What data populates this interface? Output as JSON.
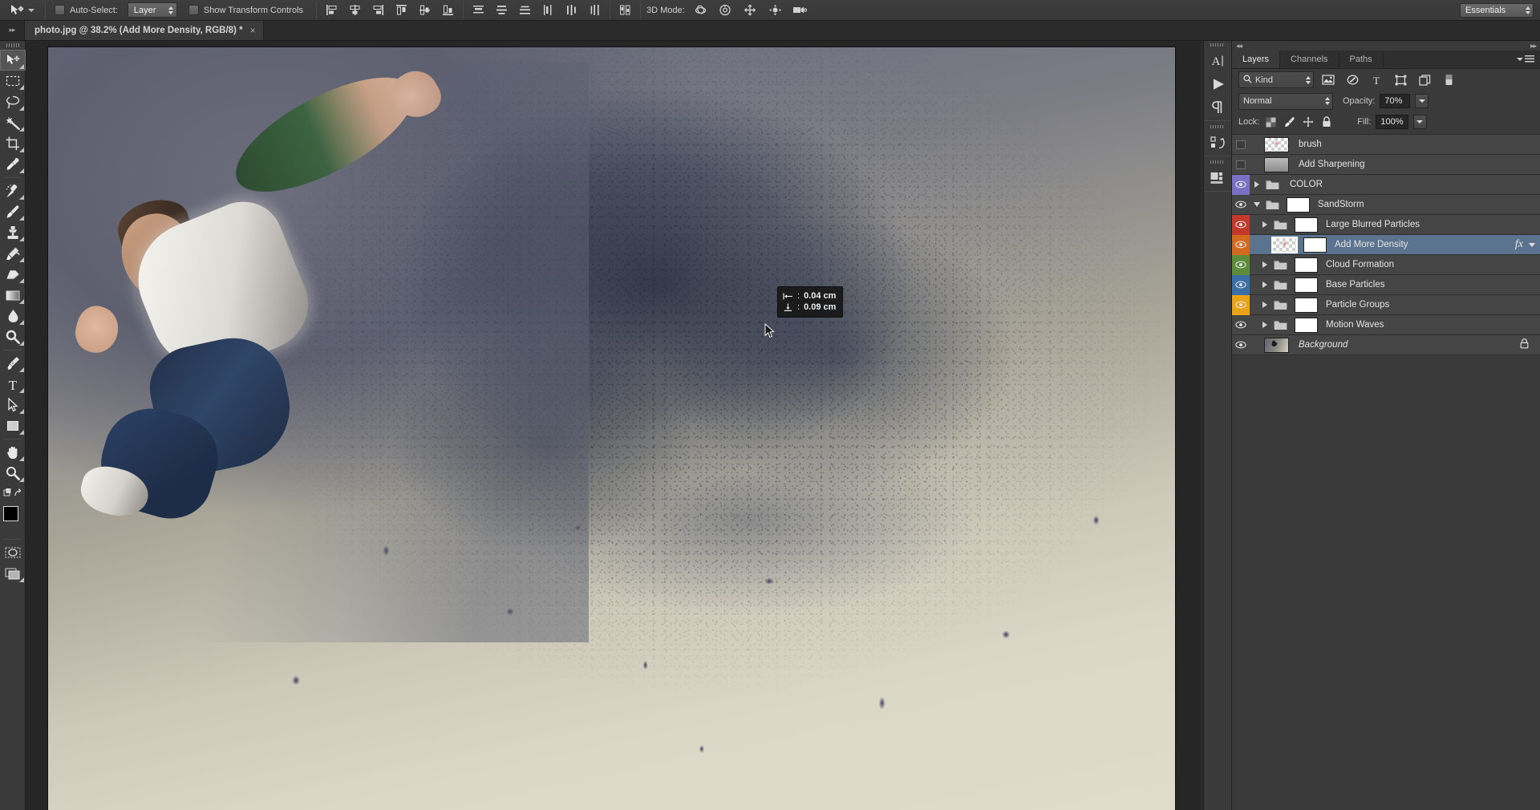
{
  "options_bar": {
    "tool_icon": "move-tool-icon",
    "auto_select_label": "Auto-Select:",
    "auto_select_target": "Layer",
    "show_transform_label": "Show Transform Controls",
    "align_icons": [
      "align-left-edges-icon",
      "align-horizontal-centers-icon",
      "align-right-edges-icon",
      "align-top-edges-icon",
      "align-vertical-centers-icon",
      "align-bottom-edges-icon"
    ],
    "distribute_icons": [
      "distribute-top-edges-icon",
      "distribute-vertical-centers-icon",
      "distribute-bottom-edges-icon",
      "distribute-left-edges-icon",
      "distribute-horizontal-centers-icon",
      "distribute-right-edges-icon"
    ],
    "auto_align_icon": "auto-align-layers-icon",
    "three_d_mode_label": "3D Mode:",
    "three_d_icons": [
      "orbit-3d-icon",
      "roll-3d-icon",
      "pan-3d-icon",
      "slide-3d-icon",
      "zoom-3d-icon"
    ],
    "workspace": "Essentials"
  },
  "document": {
    "tab_title": "photo.jpg @ 38.2% (Add More Density, RGB/8) *",
    "close_label": "×",
    "zoom_level": "38.2%",
    "color_mode": "RGB/8",
    "active_layer": "Add More Density",
    "modified": true
  },
  "toolbar": {
    "tools": [
      {
        "name": "move-tool",
        "active": true,
        "has_flyout": true
      },
      {
        "name": "rectangular-marquee-tool",
        "active": false,
        "has_flyout": true
      },
      {
        "name": "lasso-tool",
        "active": false,
        "has_flyout": true
      },
      {
        "name": "magic-wand-tool",
        "active": false,
        "has_flyout": true
      },
      {
        "name": "crop-tool",
        "active": false,
        "has_flyout": true
      },
      {
        "name": "eyedropper-tool",
        "active": false,
        "has_flyout": true
      },
      {
        "name": "spot-healing-brush-tool",
        "active": false,
        "has_flyout": true
      },
      {
        "name": "brush-tool",
        "active": false,
        "has_flyout": true
      },
      {
        "name": "clone-stamp-tool",
        "active": false,
        "has_flyout": true
      },
      {
        "name": "history-brush-tool",
        "active": false,
        "has_flyout": true
      },
      {
        "name": "eraser-tool",
        "active": false,
        "has_flyout": true
      },
      {
        "name": "gradient-tool",
        "active": false,
        "has_flyout": true
      },
      {
        "name": "blur-tool",
        "active": false,
        "has_flyout": true
      },
      {
        "name": "dodge-tool",
        "active": false,
        "has_flyout": true
      },
      {
        "name": "pen-tool",
        "active": false,
        "has_flyout": true
      },
      {
        "name": "type-tool",
        "active": false,
        "has_flyout": true
      },
      {
        "name": "path-selection-tool",
        "active": false,
        "has_flyout": true
      },
      {
        "name": "rectangle-tool",
        "active": false,
        "has_flyout": true
      },
      {
        "name": "hand-tool",
        "active": false,
        "has_flyout": true
      },
      {
        "name": "zoom-tool",
        "active": false,
        "has_flyout": true
      }
    ],
    "foreground_color": "#000000",
    "background_color": "#ffffff",
    "quick_mask": "edit-in-quick-mask-icon",
    "screen_mode": "change-screen-mode-icon"
  },
  "measurement_hud": {
    "horizontal_icon": "horizontal-offset-icon",
    "horizontal_value": "0.04 cm",
    "vertical_icon": "vertical-offset-icon",
    "vertical_value": "0.09 cm"
  },
  "icon_dock": {
    "items": [
      {
        "name": "character-panel-icon"
      },
      {
        "name": "timeline-panel-icon"
      },
      {
        "name": "paragraph-panel-icon"
      },
      {
        "name": "history-panel-icon"
      },
      {
        "name": "libraries-panel-icon"
      }
    ]
  },
  "layers_panel": {
    "tabs": [
      {
        "label": "Layers",
        "active": true
      },
      {
        "label": "Channels",
        "active": false
      },
      {
        "label": "Paths",
        "active": false
      }
    ],
    "menu_icon": "panel-menu-icon",
    "filter": {
      "search_icon": "search-icon",
      "kind_label": "Kind",
      "type_filters": [
        "filter-pixel-layers-icon",
        "filter-adjustment-layers-icon",
        "filter-type-layers-icon",
        "filter-shape-layers-icon",
        "filter-smart-object-icon"
      ],
      "toggle_icon": "filter-toggle-icon"
    },
    "blend_mode": "Normal",
    "opacity_label": "Opacity:",
    "opacity_value": "70%",
    "lock_label": "Lock:",
    "lock_icons": [
      "lock-transparent-pixels-icon",
      "lock-image-pixels-icon",
      "lock-position-icon",
      "lock-all-icon"
    ],
    "fill_label": "Fill:",
    "fill_value": "100%",
    "layers": [
      {
        "name": "brush",
        "visible": false,
        "type": "layer",
        "thumb": "checker",
        "color": "none",
        "expanded": false,
        "has_fx": false,
        "locked": false,
        "selected": false,
        "has_mask": false
      },
      {
        "name": "Add Sharpening",
        "visible": false,
        "type": "layer",
        "thumb": "gray",
        "color": "none",
        "expanded": false,
        "has_fx": false,
        "locked": false,
        "selected": false,
        "has_mask": false
      },
      {
        "name": "COLOR",
        "visible": true,
        "type": "group",
        "color": "#7b6fc4",
        "expanded": false,
        "has_fx": false,
        "locked": false,
        "selected": false,
        "has_mask": false
      },
      {
        "name": "SandStorm",
        "visible": true,
        "type": "group",
        "color": "none",
        "expanded": true,
        "has_fx": false,
        "locked": false,
        "selected": false,
        "has_mask": true
      },
      {
        "name": "Large Blurred Particles",
        "visible": true,
        "type": "group",
        "color": "#c0392b",
        "expanded": false,
        "has_fx": false,
        "locked": false,
        "selected": false,
        "has_mask": true,
        "indent": 1
      },
      {
        "name": "Add More Density",
        "visible": true,
        "type": "layer",
        "thumb": "checker",
        "color": "#d2691e",
        "expanded": false,
        "has_fx": true,
        "locked": false,
        "selected": true,
        "has_mask": true,
        "indent": 1
      },
      {
        "name": "Cloud Formation",
        "visible": true,
        "type": "group",
        "color": "#5e8c3a",
        "expanded": false,
        "has_fx": false,
        "locked": false,
        "selected": false,
        "has_mask": true,
        "indent": 1
      },
      {
        "name": "Base Particles",
        "visible": true,
        "type": "group",
        "color": "#3a6ea5",
        "expanded": false,
        "has_fx": false,
        "locked": false,
        "selected": false,
        "has_mask": true,
        "indent": 1
      },
      {
        "name": "Particle Groups",
        "visible": true,
        "type": "group",
        "color": "#e8a317",
        "expanded": false,
        "has_fx": false,
        "locked": false,
        "selected": false,
        "has_mask": true,
        "indent": 1
      },
      {
        "name": "Motion Waves",
        "visible": true,
        "type": "group",
        "color": "none",
        "expanded": false,
        "has_fx": false,
        "locked": false,
        "selected": false,
        "has_mask": true,
        "indent": 1
      },
      {
        "name": "Background",
        "visible": true,
        "type": "background",
        "thumb": "photo",
        "color": "none",
        "expanded": false,
        "has_fx": false,
        "locked": true,
        "selected": false,
        "has_mask": false
      }
    ]
  },
  "colors": {
    "panel_bg": "#3a3a3a",
    "canvas_bg": "#262626",
    "selection_blue": "#5b738f",
    "options_bar": "#3d3d3d"
  }
}
